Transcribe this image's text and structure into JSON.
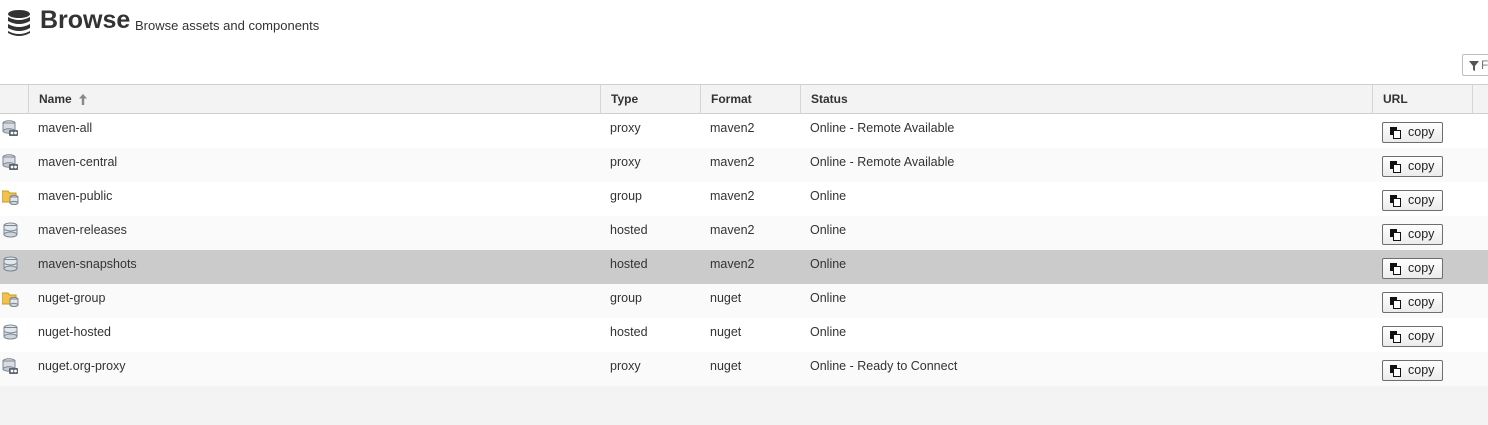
{
  "header": {
    "title": "Browse",
    "subtitle": "Browse assets and components",
    "icon": "database-icon"
  },
  "filter": {
    "placeholder": "F",
    "icon": "filter-icon"
  },
  "table": {
    "columns": {
      "name": "Name",
      "type": "Type",
      "format": "Format",
      "status": "Status",
      "url": "URL"
    },
    "sort": {
      "column": "name",
      "direction": "ascending",
      "icon": "arrow-up-icon"
    },
    "rows": [
      {
        "icon": "proxy-repo-icon",
        "name": "maven-all",
        "type": "proxy",
        "format": "maven2",
        "status": "Online - Remote Available",
        "url_button": "copy"
      },
      {
        "icon": "proxy-repo-icon",
        "name": "maven-central",
        "type": "proxy",
        "format": "maven2",
        "status": "Online - Remote Available",
        "url_button": "copy"
      },
      {
        "icon": "group-repo-icon",
        "name": "maven-public",
        "type": "group",
        "format": "maven2",
        "status": "Online",
        "url_button": "copy"
      },
      {
        "icon": "hosted-repo-icon",
        "name": "maven-releases",
        "type": "hosted",
        "format": "maven2",
        "status": "Online",
        "url_button": "copy"
      },
      {
        "icon": "hosted-repo-icon",
        "name": "maven-snapshots",
        "type": "hosted",
        "format": "maven2",
        "status": "Online",
        "url_button": "copy",
        "selected": true
      },
      {
        "icon": "group-repo-icon",
        "name": "nuget-group",
        "type": "group",
        "format": "nuget",
        "status": "Online",
        "url_button": "copy"
      },
      {
        "icon": "hosted-repo-icon",
        "name": "nuget-hosted",
        "type": "hosted",
        "format": "nuget",
        "status": "Online",
        "url_button": "copy"
      },
      {
        "icon": "proxy-repo-icon",
        "name": "nuget.org-proxy",
        "type": "proxy",
        "format": "nuget",
        "status": "Online - Ready to Connect",
        "url_button": "copy"
      }
    ]
  },
  "colors": {
    "selected_row": "#cbcbcb",
    "alt_row": "#fafafa",
    "group_folder": "#f2c14e"
  }
}
